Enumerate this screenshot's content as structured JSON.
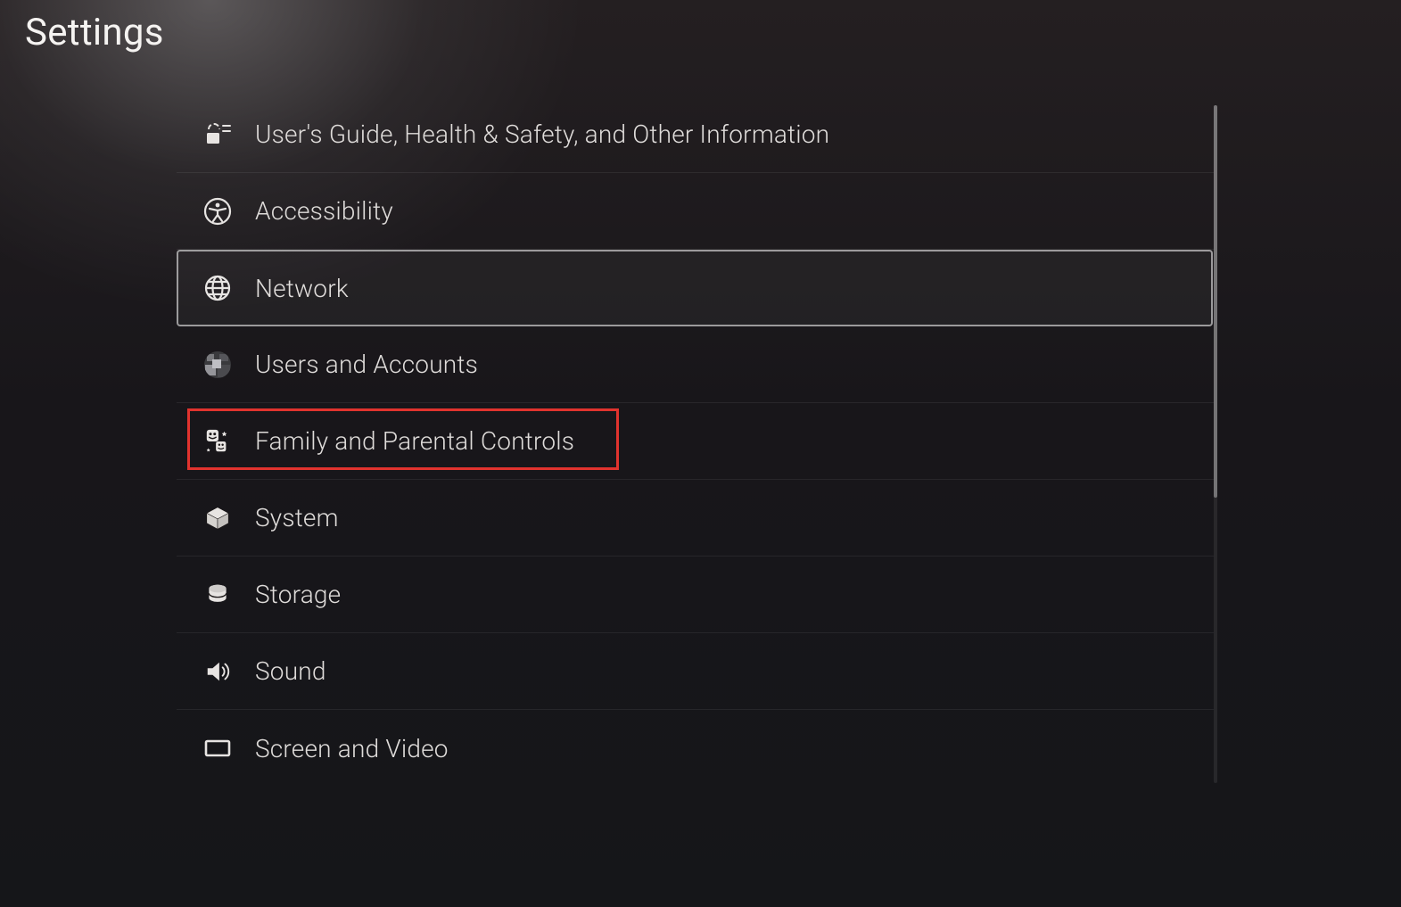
{
  "page": {
    "title": "Settings"
  },
  "menu": {
    "items": [
      {
        "label": "User's Guide, Health & Safety, and Other Information",
        "icon": "guide-icon",
        "selected": false,
        "highlighted": false
      },
      {
        "label": "Accessibility",
        "icon": "accessibility-icon",
        "selected": false,
        "highlighted": false
      },
      {
        "label": "Network",
        "icon": "globe-icon",
        "selected": true,
        "highlighted": false
      },
      {
        "label": "Users and Accounts",
        "icon": "avatar-icon",
        "selected": false,
        "highlighted": false
      },
      {
        "label": "Family and Parental Controls",
        "icon": "family-icon",
        "selected": false,
        "highlighted": true
      },
      {
        "label": "System",
        "icon": "cube-icon",
        "selected": false,
        "highlighted": false
      },
      {
        "label": "Storage",
        "icon": "storage-icon",
        "selected": false,
        "highlighted": false
      },
      {
        "label": "Sound",
        "icon": "sound-icon",
        "selected": false,
        "highlighted": false
      },
      {
        "label": "Screen and Video",
        "icon": "screen-icon",
        "selected": false,
        "highlighted": false
      }
    ]
  },
  "annotation": {
    "highlight_color": "#e1332e"
  }
}
